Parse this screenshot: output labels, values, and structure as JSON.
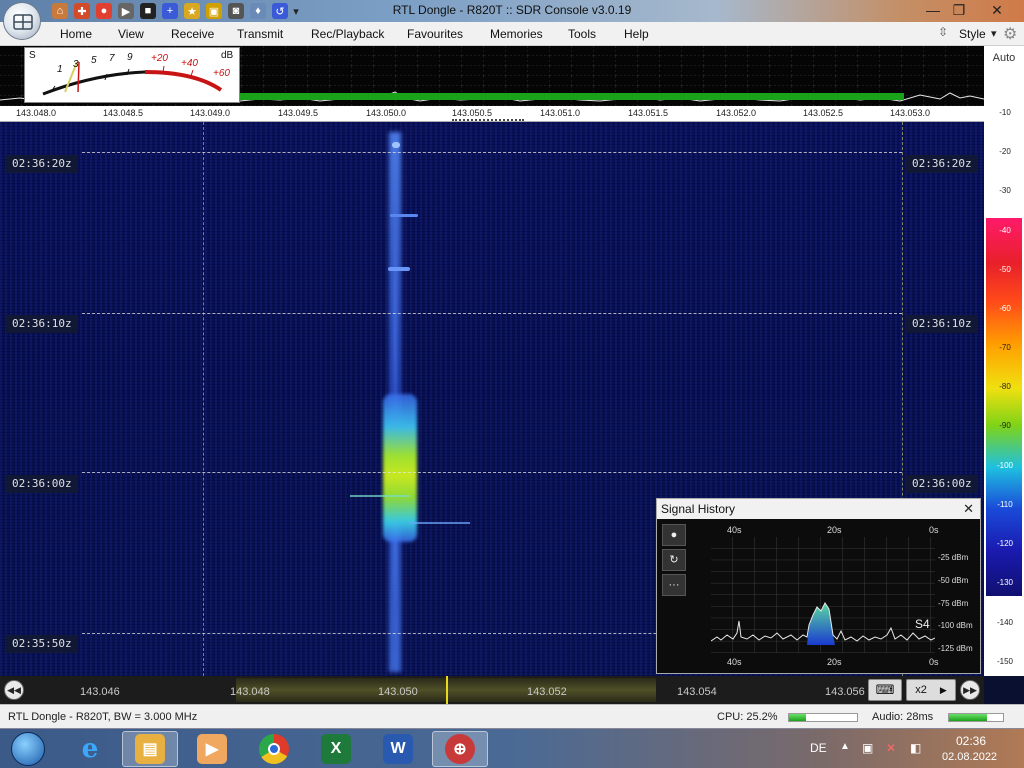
{
  "window": {
    "title": "RTL Dongle - R820T :: SDR Console v3.0.19",
    "minimize": "—",
    "maximize": "❐",
    "close": "✕"
  },
  "menu": {
    "items": [
      "Home",
      "View",
      "Receive",
      "Transmit",
      "Rec/Playback",
      "Favourites",
      "Memories",
      "Tools",
      "Help"
    ],
    "style_label": "Style",
    "style_arrow": "▾"
  },
  "smeter": {
    "s_label": "S",
    "db_label": "dB",
    "scale": [
      "1",
      "3",
      "5",
      "7",
      "9",
      "+20",
      "+40",
      "+60"
    ]
  },
  "freq_scale": [
    "143.048.0",
    "143.048.5",
    "143.049.0",
    "143.049.5",
    "143.050.0",
    "143.050.5",
    "143.051.0",
    "143.051.5",
    "143.052.0",
    "143.052.5",
    "143.053.0"
  ],
  "right_scale": {
    "auto_label": "Auto",
    "levels": [
      "-10",
      "-20",
      "-30",
      "-40",
      "-50",
      "-60",
      "-70",
      "-80",
      "-90",
      "-100",
      "-110",
      "-120",
      "-130",
      "-140",
      "-150"
    ],
    "colors": {
      "-40": "#ff1a6a",
      "-50": "#e8202a",
      "-60": "#ff4a1a",
      "-70": "#ffa200",
      "-80": "#f0e010",
      "-90": "#7ed318",
      "-100": "#1ec0e0",
      "-110": "#1a4ad8",
      "-120": "#1a1ab0",
      "-130": "#101070"
    }
  },
  "waterfall": {
    "times": [
      "02:36:20z",
      "02:36:10z",
      "02:36:00z",
      "02:35:50z"
    ]
  },
  "signal_history": {
    "title": "Signal History",
    "close": "✕",
    "buttons": [
      "●",
      "↻",
      "···"
    ],
    "time_labels": [
      "40s",
      "20s",
      "0s"
    ],
    "levels": [
      "-25 dBm",
      "-50 dBm",
      "-75 dBm",
      "-100 dBm",
      "-125 dBm"
    ],
    "s_reading": "S4"
  },
  "tuner": {
    "freqs": [
      "143.046",
      "143.048",
      "143.050",
      "143.052",
      "143.054",
      "143.056"
    ],
    "zoom": "x2"
  },
  "status": {
    "device": "RTL Dongle - R820T, BW = 3.000 MHz",
    "cpu": "CPU: 25.2%",
    "cpu_fraction": 0.252,
    "audio": "Audio: 28ms",
    "audio_fraction": 0.7
  },
  "taskbar": {
    "language": "DE",
    "time": "02:36",
    "date": "02.08.2022"
  },
  "colors": {
    "waterfall_bg": "#0c1660",
    "spectrum_green": "#1aa31a"
  }
}
